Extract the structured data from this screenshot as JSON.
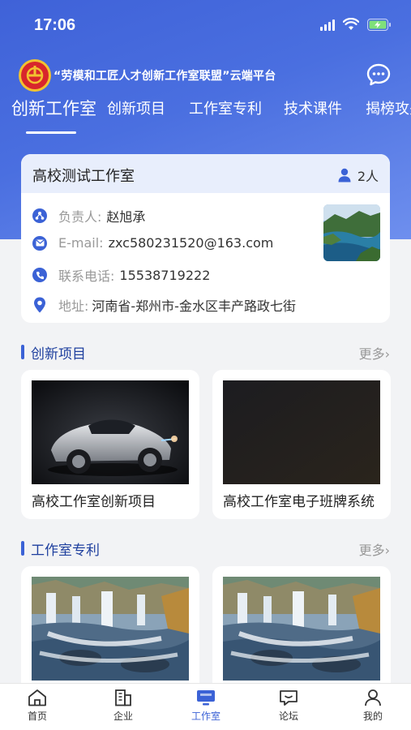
{
  "status": {
    "time": "17:06"
  },
  "header": {
    "platform_title": "“劳模和工匠人才创新工作室联盟”云端平台",
    "tabs": [
      "创新工作室",
      "创新项目",
      "工作室专利",
      "技术课件",
      "揭榜攻关"
    ],
    "active_tab": 0
  },
  "studio": {
    "name": "高校测试工作室",
    "members": "2人",
    "leader_label": "负责人:",
    "leader": "赵旭承",
    "email_label": "E-mail:",
    "email": "zxc580231520@163.com",
    "phone_label": "联系电话:",
    "phone": "15538719222",
    "address_label": "地址:",
    "address": "河南省-郑州市-金水区丰产路政七街"
  },
  "sections": {
    "projects": {
      "title": "创新项目",
      "more": "更多",
      "items": [
        {
          "title": "高校工作室创新项目"
        },
        {
          "title": "高校工作室电子班牌系统"
        }
      ]
    },
    "patents": {
      "title": "工作室专利",
      "more": "更多"
    }
  },
  "tabbar": {
    "items": [
      {
        "label": "首页",
        "icon": "home-icon"
      },
      {
        "label": "企业",
        "icon": "building-icon"
      },
      {
        "label": "工作室",
        "icon": "monitor-icon"
      },
      {
        "label": "论坛",
        "icon": "forum-icon"
      },
      {
        "label": "我的",
        "icon": "user-icon"
      }
    ],
    "active": 2
  },
  "colors": {
    "brand_blue": "#3b62d6",
    "header_gradient_start": "#3f62d8",
    "header_gradient_end": "#6e8fee",
    "logo_red": "#d8262c",
    "logo_gold": "#f2c230"
  }
}
